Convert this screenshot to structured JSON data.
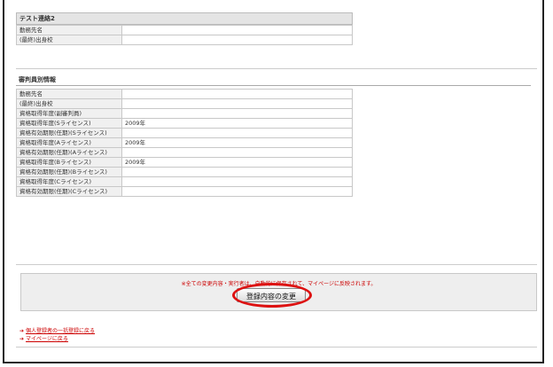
{
  "section_top": {
    "title": "テスト連絡2",
    "rows": [
      {
        "label": "勤務先名",
        "value": ""
      },
      {
        "label": "(最終)出身校",
        "value": ""
      }
    ]
  },
  "section_ref": {
    "title": "審判員別情報",
    "rows": [
      {
        "label": "勤務先名",
        "value": ""
      },
      {
        "label": "(最終)出身校",
        "value": ""
      },
      {
        "label": "資格取得年度(副審判員)",
        "value": ""
      },
      {
        "label": "資格取得年度(Sライセンス)",
        "value": "2009年"
      },
      {
        "label": "資格有効期限(任期)(Sライセンス)",
        "value": ""
      },
      {
        "label": "資格取得年度(Aライセンス)",
        "value": "2009年"
      },
      {
        "label": "資格有効期限(任期)(Aライセンス)",
        "value": ""
      },
      {
        "label": "資格取得年度(Bライセンス)",
        "value": "2009年"
      },
      {
        "label": "資格有効期限(任期)(Bライセンス)",
        "value": ""
      },
      {
        "label": "資格取得年度(Cライセンス)",
        "value": ""
      },
      {
        "label": "資格有効期限(任期)(Cライセンス)",
        "value": ""
      }
    ]
  },
  "footer": {
    "notice": "※全ての変更内容・実行者は、自動的に保存されて、マイページに反映されます。",
    "submit_label": "登録内容の変更"
  },
  "links": [
    {
      "label": "個人登録者の一括登録に戻る"
    },
    {
      "label": "マイページに戻る"
    }
  ],
  "colors": {
    "accent_red": "#cc0000",
    "highlight_ring": "#dd1111"
  }
}
